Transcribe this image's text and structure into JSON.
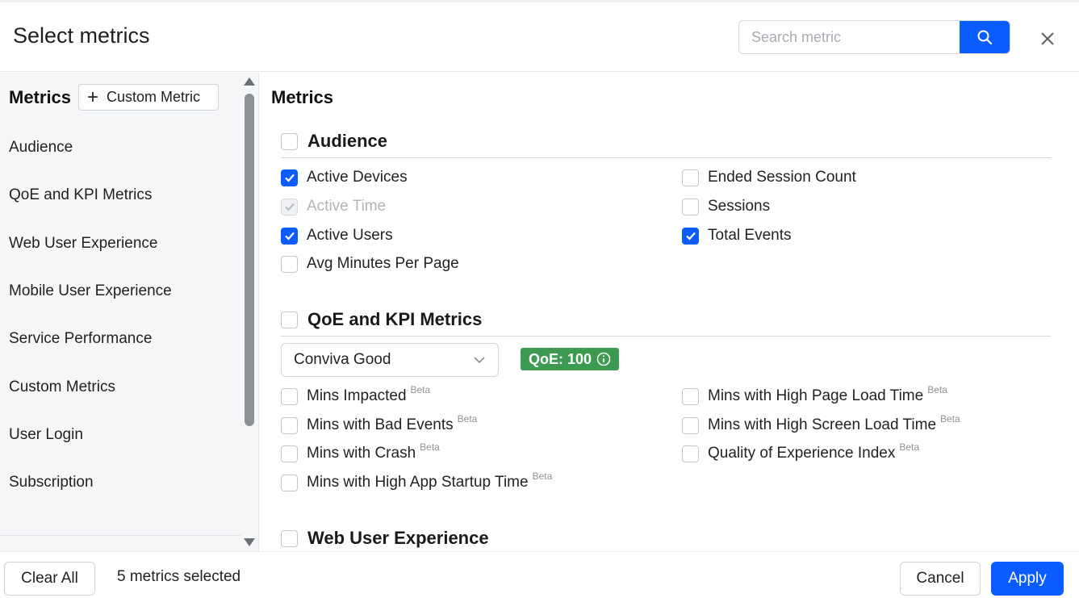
{
  "header": {
    "title": "Select metrics",
    "search_placeholder": "Search metric"
  },
  "sidebar": {
    "heading": "Metrics",
    "custom_metric_label": "Custom Metric",
    "items": [
      {
        "label": "Audience"
      },
      {
        "label": "QoE and KPI Metrics"
      },
      {
        "label": "Web User Experience"
      },
      {
        "label": "Mobile User Experience"
      },
      {
        "label": "Service Performance"
      },
      {
        "label": "Custom Metrics"
      },
      {
        "label": "User Login"
      },
      {
        "label": "Subscription"
      }
    ]
  },
  "main": {
    "heading": "Metrics",
    "sections": {
      "audience": {
        "title": "Audience",
        "checked": false,
        "metrics": [
          {
            "label": "Active Devices",
            "state": "checked"
          },
          {
            "label": "Active Time",
            "state": "disabled-checked"
          },
          {
            "label": "Active Users",
            "state": "checked"
          },
          {
            "label": "Avg Minutes Per Page",
            "state": "unchecked"
          },
          {
            "label": "Ended Session Count",
            "state": "unchecked"
          },
          {
            "label": "Sessions",
            "state": "unchecked"
          },
          {
            "label": "Total Events",
            "state": "checked"
          }
        ]
      },
      "qoe": {
        "title": "QoE and KPI Metrics",
        "checked": false,
        "dropdown_value": "Conviva Good",
        "badge": "QoE: 100",
        "badge_color": "#3d9a51",
        "beta_label": "Beta",
        "metrics": [
          {
            "label": "Mins Impacted",
            "state": "unchecked",
            "beta": true
          },
          {
            "label": "Mins with Bad Events",
            "state": "unchecked",
            "beta": true
          },
          {
            "label": "Mins with Crash",
            "state": "unchecked",
            "beta": true
          },
          {
            "label": "Mins with High App Startup Time",
            "state": "unchecked",
            "beta": true
          },
          {
            "label": "Mins with High Page Load Time",
            "state": "unchecked",
            "beta": true
          },
          {
            "label": "Mins with High Screen Load Time",
            "state": "unchecked",
            "beta": true
          },
          {
            "label": "Quality of Experience Index",
            "state": "unchecked",
            "beta": true
          }
        ]
      },
      "web": {
        "title": "Web User Experience",
        "checked": false
      }
    }
  },
  "footer": {
    "clear_all_label": "Clear All",
    "selected_count": "5 metrics selected",
    "cancel_label": "Cancel",
    "apply_label": "Apply"
  },
  "colors": {
    "accent": "#0a5cff"
  }
}
